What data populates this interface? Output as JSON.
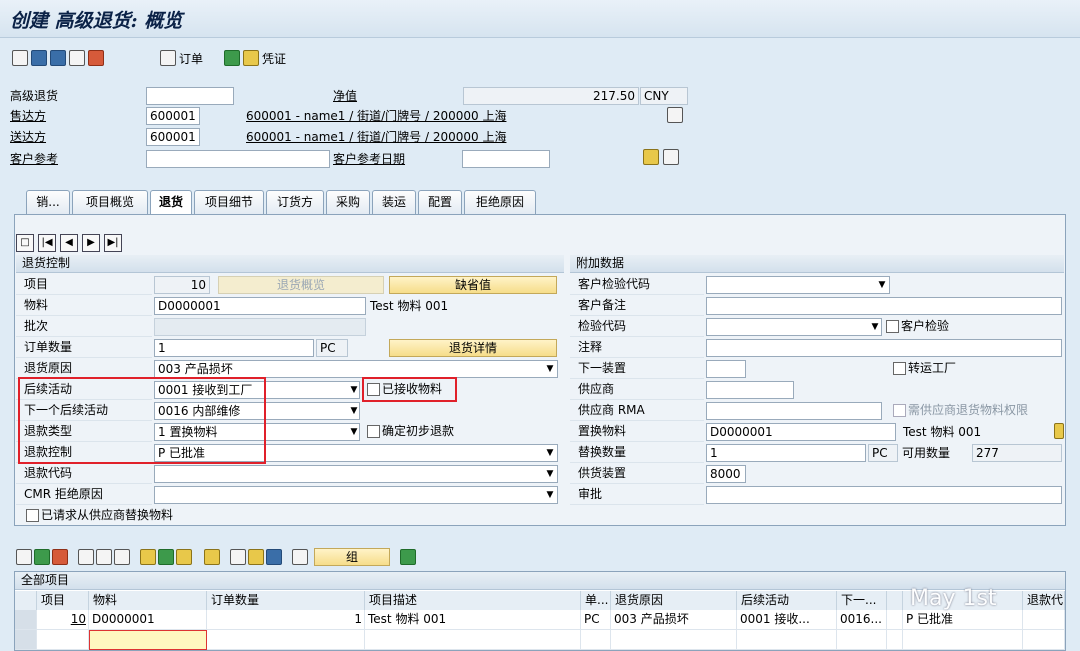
{
  "window": {
    "title": "创建 高级退货: 概览"
  },
  "toolbar": {
    "order_label": "订单",
    "voucher_label": "凭证"
  },
  "header": {
    "adv_return_label": "高级退货",
    "net_value_label": "净值",
    "net_value": "217.50",
    "currency": "CNY",
    "sold_to_label": "售达方",
    "sold_to_value": "600001",
    "sold_to_desc": "600001 - name1 / 街道/门牌号 / 200000 上海",
    "ship_to_label": "送达方",
    "ship_to_value": "600001",
    "ship_to_desc": "600001 - name1 / 街道/门牌号 / 200000 上海",
    "cust_ref_label": "客户参考",
    "cust_ref_date_label": "客户参考日期"
  },
  "tabs": [
    "销...",
    "项目概览",
    "退货",
    "项目细节",
    "订货方",
    "采购",
    "装运",
    "配置",
    "拒绝原因"
  ],
  "return_control": {
    "title": "退货控制",
    "item_label": "项目",
    "item_value": "10",
    "return_overview_btn": "退货概览",
    "default_btn": "缺省值",
    "material_label": "物料",
    "material_value": "D0000001",
    "material_desc": "Test 物料 001",
    "batch_label": "批次",
    "order_qty_label": "订单数量",
    "order_qty_value": "1",
    "order_qty_unit": "PC",
    "return_detail_btn": "退货详情",
    "return_reason_label": "退货原因",
    "return_reason_value": "003 产品损坏",
    "followup_label": "后续活动",
    "followup_value": "0001 接收到工厂",
    "received_material_label": "已接收物料",
    "next_followup_label": "下一个后续活动",
    "next_followup_value": "0016 内部维修",
    "refund_type_label": "退款类型",
    "refund_type_value": "1 置换物料",
    "confirm_refund_label": "确定初步退款",
    "refund_control_label": "退款控制",
    "refund_control_value": "P 已批准",
    "refund_code_label": "退款代码",
    "cmr_label": "CMR 拒绝原因",
    "requested_replacement_label": "已请求从供应商替换物料"
  },
  "additional": {
    "title": "附加数据",
    "inspection_code_label": "客户检验代码",
    "customer_note_label": "客户备注",
    "check_code_label": "检验代码",
    "customer_check_label": "客户检验",
    "note_label": "注释",
    "next_device_label": "下一装置",
    "transfer_plant_label": "转运工厂",
    "supplier_label": "供应商",
    "supplier_rma_label": "供应商 RMA",
    "supplier_auth_label": "需供应商退货物料权限",
    "replacement_material_label": "置换物料",
    "replacement_material_value": "D0000001",
    "replacement_material_desc": "Test 物料 001",
    "replacement_qty_label": "替换数量",
    "replacement_qty_value": "1",
    "replacement_qty_unit": "PC",
    "available_qty_label": "可用数量",
    "available_qty_value": "277",
    "supply_device_label": "供货装置",
    "supply_device_value": "8000",
    "approval_label": "审批"
  },
  "bottom_toolbar": {
    "group_btn": "组"
  },
  "table": {
    "title": "全部项目",
    "columns": [
      "项目",
      "物料",
      "订单数量",
      "项目描述",
      "单...",
      "退货原因",
      "后续活动",
      "下一...",
      "",
      "",
      "退款代"
    ],
    "rows": [
      {
        "item": "10",
        "material": "D0000001",
        "qty": "1",
        "desc": "Test 物料 001",
        "unit": "PC",
        "reason": "003 产品损坏",
        "followup": "0001 接收...",
        "next": "0016...",
        "refund_control": "P 已批准"
      }
    ]
  },
  "watermark": "May 1st"
}
